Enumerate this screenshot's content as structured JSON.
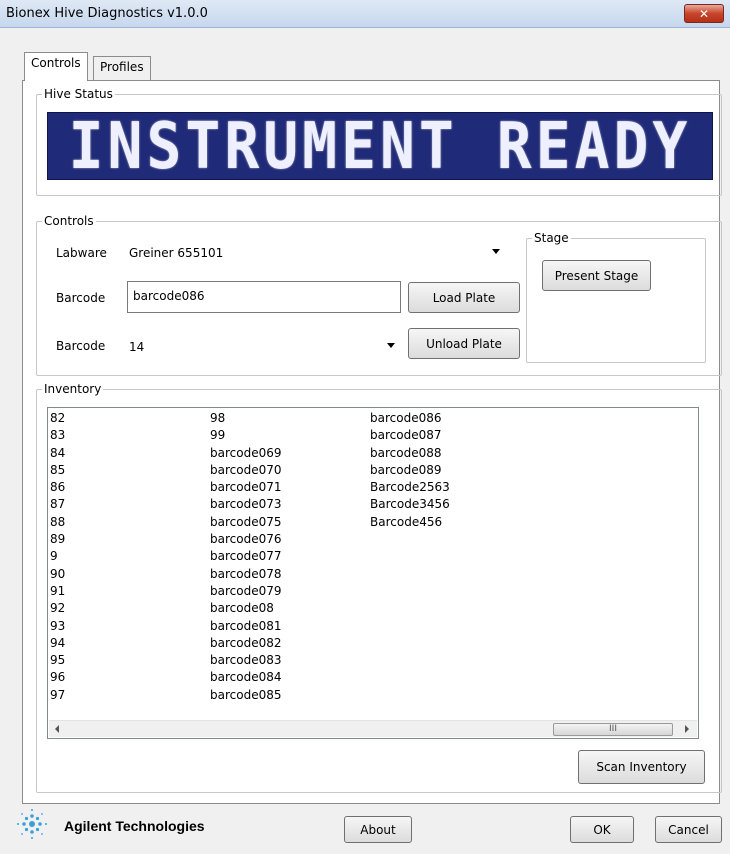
{
  "window": {
    "title": "Bionex Hive Diagnostics v1.0.0",
    "close_glyph": "✕"
  },
  "tabs": [
    {
      "label": "Controls",
      "active": true
    },
    {
      "label": "Profiles",
      "active": false
    }
  ],
  "hive_status": {
    "group_label": "Hive Status",
    "display_text": "INSTRUMENT READY",
    "display_bg": "#1f2a78"
  },
  "controls": {
    "group_label": "Controls",
    "labware_label": "Labware",
    "labware_value": "Greiner 655101",
    "barcode_label": "Barcode",
    "barcode_input_value": "barcode086",
    "load_plate_button": "Load Plate",
    "barcode2_label": "Barcode",
    "barcode2_value": "14",
    "unload_plate_button": "Unload Plate"
  },
  "stage": {
    "group_label": "Stage",
    "present_stage_button": "Present Stage"
  },
  "inventory": {
    "group_label": "Inventory",
    "columns": [
      [
        "82",
        "83",
        "84",
        "85",
        "86",
        "87",
        "88",
        "89",
        "9",
        "90",
        "91",
        "92",
        "93",
        "94",
        "95",
        "96",
        "97"
      ],
      [
        "98",
        "99",
        "barcode069",
        "barcode070",
        "barcode071",
        "barcode073",
        "barcode075",
        "barcode076",
        "barcode077",
        "barcode078",
        "barcode079",
        "barcode08",
        "barcode081",
        "barcode082",
        "barcode083",
        "barcode084",
        "barcode085"
      ],
      [
        "barcode086",
        "barcode087",
        "barcode088",
        "barcode089",
        "Barcode2563",
        "Barcode3456",
        "Barcode456"
      ]
    ],
    "scroll_thumb_glyph": "III",
    "scan_inventory_button": "Scan Inventory"
  },
  "footer": {
    "logo_text": "Agilent Technologies",
    "about_button": "About",
    "ok_button": "OK",
    "cancel_button": "Cancel"
  }
}
